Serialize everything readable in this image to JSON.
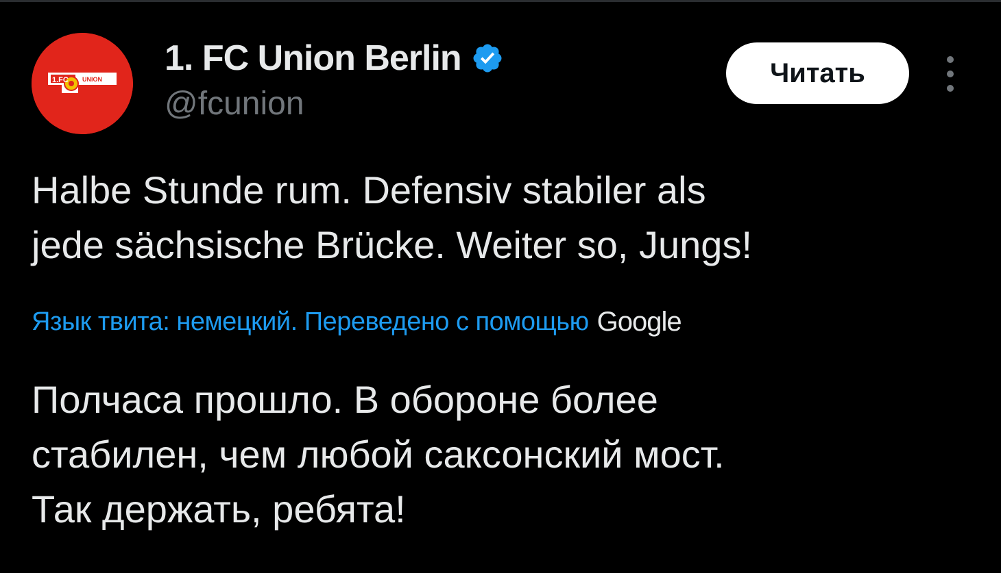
{
  "tweet": {
    "author": {
      "name": "1. FC Union Berlin",
      "handle": "@fcunion",
      "verified": true,
      "avatar": {
        "logo_text": "UNION",
        "logo_number": "1.FC",
        "background_color": "#e1251b"
      }
    },
    "follow_button_label": "Читать",
    "original_text": "Halbe Stunde rum. Defensiv stabiler als\njede sächsische Brücke. Weiter so, Jungs!",
    "translation_note": "Язык твита: немецкий. Переведено с помощью",
    "translation_provider": "Google",
    "translated_text": "Полчаса прошло. В обороне более\nстабилен, чем любой саксонский мост.\nТак держать, ребята!"
  },
  "colors": {
    "background": "#000000",
    "primary_text": "#e7e9ea",
    "secondary_text": "#71767b",
    "link": "#1d9bf0",
    "verified_badge": "#1d9bf0"
  },
  "icons": {
    "verified": "verified-badge-icon",
    "more": "more-dots-icon"
  }
}
